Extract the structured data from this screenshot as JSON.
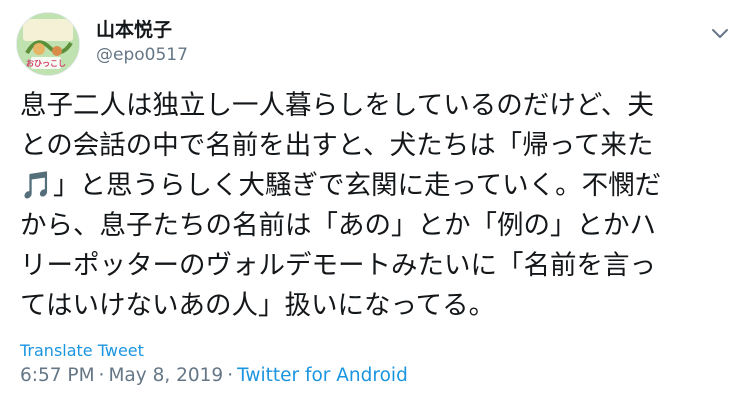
{
  "user": {
    "display_name": "山本悦子",
    "handle": "@epo0517",
    "avatar_logo_text": "おひっこし"
  },
  "tweet": {
    "lines": [
      "息子二人は独立し一人暮らしをしているのだけど、夫",
      "との会話の中で名前を出すと、犬たちは「帰って来た",
      "🎵」と思うらしく大騒ぎで玄関に走っていく。不憫だ",
      "から、息子たちの名前は「あの」とか「例の」とかハ",
      "リーポッターのヴォルデモートみたいに「名前を言っ",
      "てはいけないあの人」扱いになってる。"
    ]
  },
  "translate_label": "Translate Tweet",
  "meta": {
    "time": "6:57 PM",
    "date": "May 8, 2019",
    "separator": "·",
    "source": "Twitter for Android"
  },
  "colors": {
    "text": "#14171a",
    "secondary": "#657786",
    "link": "#1b95e0"
  },
  "icons": {
    "caret": "chevron-down-icon"
  }
}
